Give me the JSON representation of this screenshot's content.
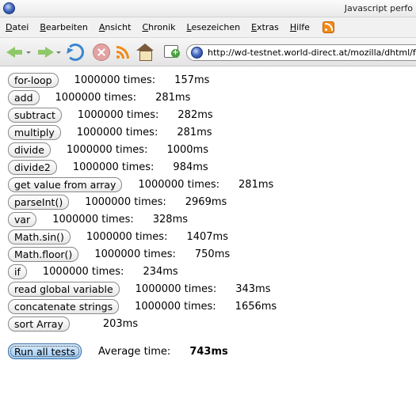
{
  "window": {
    "title": "Javascript perfo"
  },
  "menubar": {
    "items": [
      {
        "label": "Datei",
        "access": "D",
        "rest": "atei"
      },
      {
        "label": "Bearbeiten",
        "access": "B",
        "rest": "earbeiten"
      },
      {
        "label": "Ansicht",
        "access": "A",
        "rest": "nsicht"
      },
      {
        "label": "Chronik",
        "access": "C",
        "rest": "hronik"
      },
      {
        "label": "Lesezeichen",
        "access": "L",
        "rest": "esezeichen"
      },
      {
        "label": "Extras",
        "access": "E",
        "rest": "xtras"
      },
      {
        "label": "Hilfe",
        "access": "H",
        "rest": "ilfe"
      }
    ]
  },
  "navbar": {
    "icons": [
      "back-icon",
      "forward-icon",
      "reload-icon",
      "stop-icon",
      "rss-icon",
      "home-icon",
      "bookmark-add-icon"
    ],
    "url": "http://wd-testnet.world-direct.at/mozilla/dhtml/funo/jsi"
  },
  "tests": [
    {
      "label": "for-loop",
      "times": "1000000 times:",
      "ms": "157ms"
    },
    {
      "label": "add",
      "times": "1000000 times:",
      "ms": "281ms"
    },
    {
      "label": "subtract",
      "times": "1000000 times:",
      "ms": "282ms"
    },
    {
      "label": "multiply",
      "times": "1000000 times:",
      "ms": "281ms"
    },
    {
      "label": "divide",
      "times": "1000000 times:",
      "ms": "1000ms"
    },
    {
      "label": "divide2",
      "times": "1000000 times:",
      "ms": "984ms"
    },
    {
      "label": "get value from array",
      "times": "1000000 times:",
      "ms": "281ms"
    },
    {
      "label": "parseInt()",
      "times": "1000000 times:",
      "ms": "2969ms"
    },
    {
      "label": "var",
      "times": "1000000 times:",
      "ms": "328ms"
    },
    {
      "label": "Math.sin()",
      "times": "1000000 times:",
      "ms": "1407ms"
    },
    {
      "label": "Math.floor()",
      "times": "1000000 times:",
      "ms": "750ms"
    },
    {
      "label": "if",
      "times": "1000000 times:",
      "ms": "234ms"
    },
    {
      "label": "read global variable",
      "times": "1000000 times:",
      "ms": "343ms"
    },
    {
      "label": "concatenate strings",
      "times": "1000000 times:",
      "ms": "1656ms"
    },
    {
      "label": "sort Array",
      "times": "",
      "ms": "203ms"
    }
  ],
  "run_all": {
    "label": "Run all tests",
    "average_label": "Average time:",
    "average_value": "743ms"
  }
}
